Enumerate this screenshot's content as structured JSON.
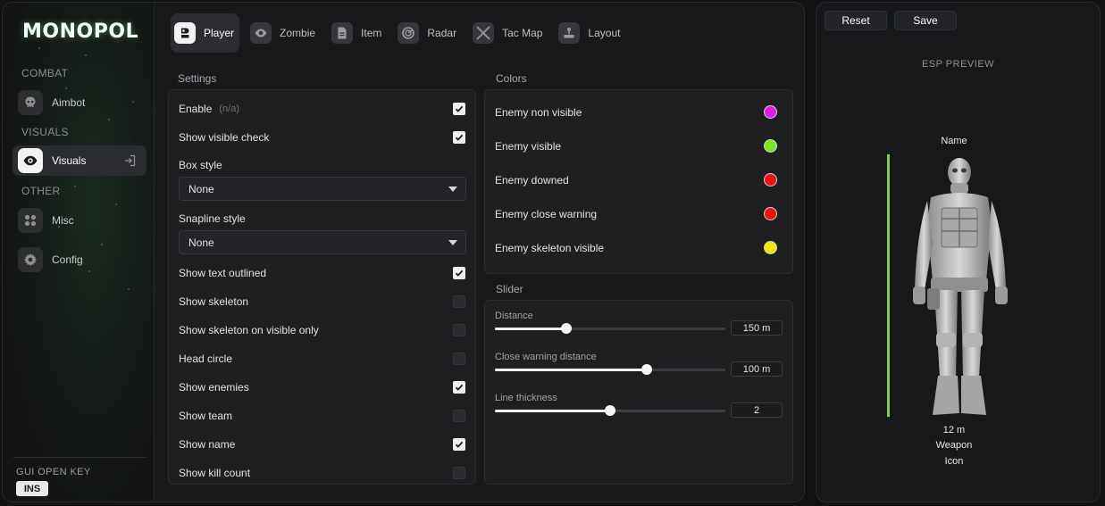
{
  "app": {
    "logo": "MONOPOL"
  },
  "sidebar": {
    "sections": [
      {
        "label": "COMBAT"
      },
      {
        "label": "VISUALS"
      },
      {
        "label": "OTHER"
      }
    ],
    "items": [
      {
        "label": "Aimbot",
        "icon": "skull-icon"
      },
      {
        "label": "Visuals",
        "icon": "eye-icon",
        "active": true
      },
      {
        "label": "Misc",
        "icon": "grid-icon"
      },
      {
        "label": "Config",
        "icon": "gear-icon"
      }
    ],
    "gui_key_label": "GUI OPEN KEY",
    "gui_key_value": "INS"
  },
  "tabs": [
    {
      "label": "Player",
      "icon": "player-icon",
      "active": true
    },
    {
      "label": "Zombie",
      "icon": "eye-icon"
    },
    {
      "label": "Item",
      "icon": "document-icon"
    },
    {
      "label": "Radar",
      "icon": "radar-icon"
    },
    {
      "label": "Tac Map",
      "icon": "crossed-swords-icon"
    },
    {
      "label": "Layout",
      "icon": "joystick-icon"
    }
  ],
  "settings": {
    "title": "Settings",
    "enable": {
      "label": "Enable",
      "hint": "(n/a)",
      "checked": true
    },
    "show_visible_check": {
      "label": "Show visible check",
      "checked": true
    },
    "box_style": {
      "label": "Box style",
      "value": "None"
    },
    "snapline_style": {
      "label": "Snapline style",
      "value": "None"
    },
    "rows": [
      {
        "label": "Show text outlined",
        "checked": true
      },
      {
        "label": "Show skeleton",
        "checked": false
      },
      {
        "label": "Show skeleton on visible only",
        "checked": false
      },
      {
        "label": "Head circle",
        "checked": false
      },
      {
        "label": "Show enemies",
        "checked": true
      },
      {
        "label": "Show team",
        "checked": false
      },
      {
        "label": "Show name",
        "checked": true
      },
      {
        "label": "Show kill count",
        "checked": false
      }
    ]
  },
  "colors": {
    "title": "Colors",
    "items": [
      {
        "label": "Enemy non visible",
        "color": "#e619e6"
      },
      {
        "label": "Enemy visible",
        "color": "#7fe61e"
      },
      {
        "label": "Enemy downed",
        "color": "#f01010"
      },
      {
        "label": "Enemy close warning",
        "color": "#f01010"
      },
      {
        "label": "Enemy skeleton visible",
        "color": "#f0e600"
      }
    ]
  },
  "slider": {
    "title": "Slider",
    "items": [
      {
        "label": "Distance",
        "value": "150 m",
        "fraction": 0.31
      },
      {
        "label": "Close warning distance",
        "value": "100 m",
        "fraction": 0.66
      },
      {
        "label": "Line thickness",
        "value": "2",
        "fraction": 0.5
      }
    ]
  },
  "preview": {
    "reset_label": "Reset",
    "save_label": "Save",
    "title": "ESP PREVIEW",
    "name": "Name",
    "distance": "12 m",
    "weapon": "Weapon",
    "icon": "Icon",
    "health_color": "#7ad64a"
  }
}
